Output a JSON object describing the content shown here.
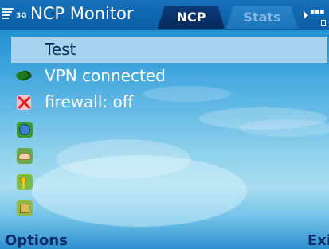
{
  "status": {
    "network": "3G",
    "app_title": "NCP Monitor"
  },
  "tabs": [
    {
      "label": "NCP",
      "active": true
    },
    {
      "label": "Stats",
      "active": false
    }
  ],
  "list": {
    "items": [
      {
        "label": "Test",
        "icon": null,
        "selected": true
      },
      {
        "label": "VPN connected",
        "icon": "vpn-status-icon"
      },
      {
        "label": "firewall: off",
        "icon": "firewall-off-icon"
      },
      {
        "label": "",
        "icon": "globe-icon"
      },
      {
        "label": "",
        "icon": "handshake-icon"
      },
      {
        "label": "",
        "icon": "key-icon"
      },
      {
        "label": "",
        "icon": "chip-icon"
      }
    ]
  },
  "softkeys": {
    "left": "Options",
    "right": "Exi"
  },
  "colors": {
    "selection": "#a7d3ef",
    "softkey_text": "#0a2a6a",
    "active_tab": "#052a5c"
  }
}
